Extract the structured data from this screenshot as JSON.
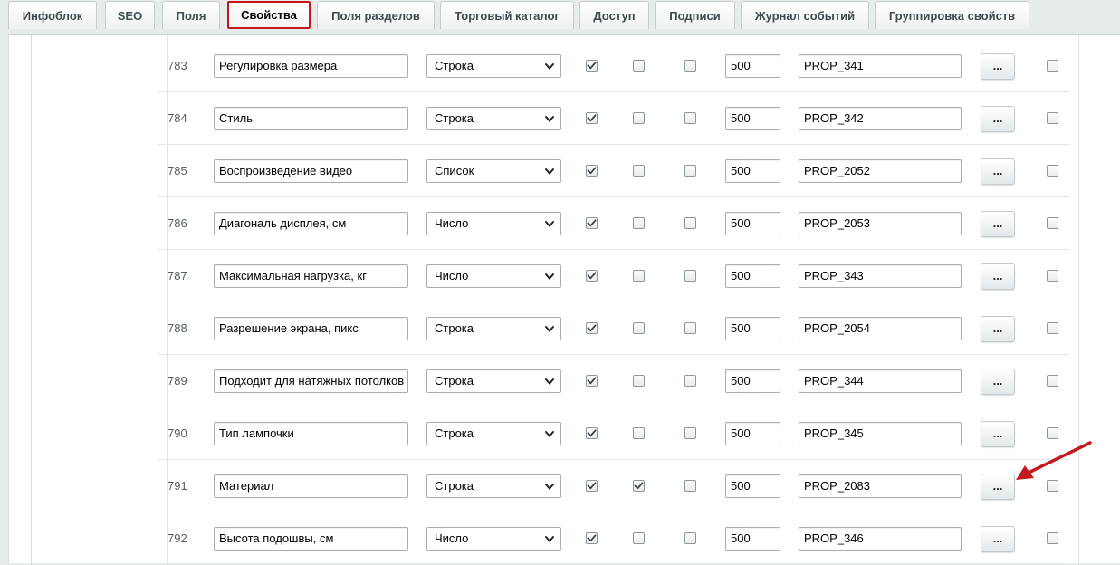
{
  "tabs": [
    {
      "label": "Инфоблок",
      "active": false
    },
    {
      "label": "SEO",
      "active": false
    },
    {
      "label": "Поля",
      "active": false
    },
    {
      "label": "Свойства",
      "active": true
    },
    {
      "label": "Поля разделов",
      "active": false
    },
    {
      "label": "Торговый каталог",
      "active": false
    },
    {
      "label": "Доступ",
      "active": false
    },
    {
      "label": "Подписи",
      "active": false
    },
    {
      "label": "Журнал событий",
      "active": false
    },
    {
      "label": "Группировка свойств",
      "active": false
    }
  ],
  "colors": {
    "active_tab_border": "#c5171d",
    "arrow": "#c21a1f"
  },
  "rows": [
    {
      "id": "783",
      "name": "Регулировка размера",
      "type": "Строка",
      "checks": [
        true,
        false,
        false
      ],
      "sort": "500",
      "code": "PROP_341",
      "more": "...",
      "delete": false
    },
    {
      "id": "784",
      "name": "Стиль",
      "type": "Строка",
      "checks": [
        true,
        false,
        false
      ],
      "sort": "500",
      "code": "PROP_342",
      "more": "...",
      "delete": false
    },
    {
      "id": "785",
      "name": "Воспроизведение видео",
      "type": "Список",
      "checks": [
        true,
        false,
        false
      ],
      "sort": "500",
      "code": "PROP_2052",
      "more": "...",
      "delete": false
    },
    {
      "id": "786",
      "name": "Диагональ дисплея, см",
      "type": "Число",
      "checks": [
        true,
        false,
        false
      ],
      "sort": "500",
      "code": "PROP_2053",
      "more": "...",
      "delete": false
    },
    {
      "id": "787",
      "name": "Максимальная нагрузка, кг",
      "type": "Число",
      "checks": [
        true,
        false,
        false
      ],
      "sort": "500",
      "code": "PROP_343",
      "more": "...",
      "delete": false
    },
    {
      "id": "788",
      "name": "Разрешение экрана, пикс",
      "type": "Строка",
      "checks": [
        true,
        false,
        false
      ],
      "sort": "500",
      "code": "PROP_2054",
      "more": "...",
      "delete": false
    },
    {
      "id": "789",
      "name": "Подходит для натяжных потолков",
      "type": "Строка",
      "checks": [
        true,
        false,
        false
      ],
      "sort": "500",
      "code": "PROP_344",
      "more": "...",
      "delete": false
    },
    {
      "id": "790",
      "name": "Тип лампочки",
      "type": "Строка",
      "checks": [
        true,
        false,
        false
      ],
      "sort": "500",
      "code": "PROP_345",
      "more": "...",
      "delete": false
    },
    {
      "id": "791",
      "name": "Материал",
      "type": "Строка",
      "checks": [
        true,
        true,
        false
      ],
      "sort": "500",
      "code": "PROP_2083",
      "more": "...",
      "delete": false
    },
    {
      "id": "792",
      "name": "Высота подошвы, см",
      "type": "Число",
      "checks": [
        true,
        false,
        false
      ],
      "sort": "500",
      "code": "PROP_346",
      "more": "...",
      "delete": false
    }
  ]
}
